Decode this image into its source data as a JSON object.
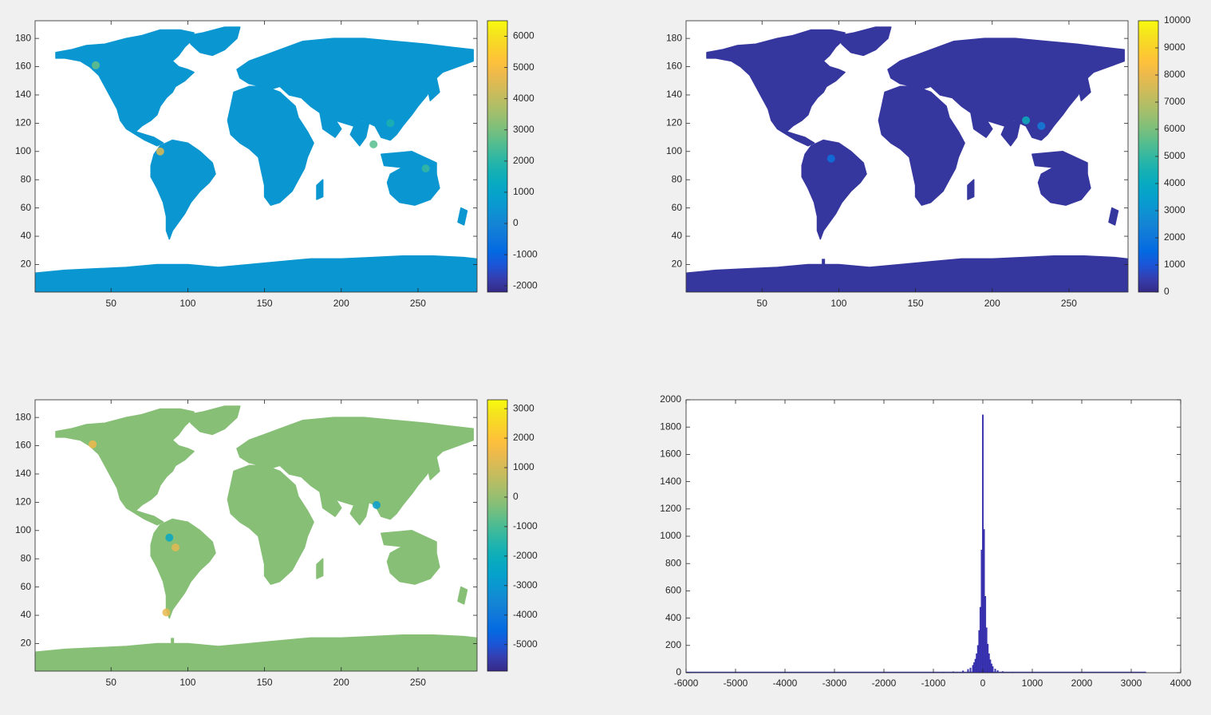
{
  "chart_data": [
    {
      "type": "heatmap",
      "panel": "top-left",
      "xlim": [
        0.5,
        288.5
      ],
      "ylim": [
        0.5,
        192.5
      ],
      "x_ticks": [
        50,
        100,
        150,
        200,
        250
      ],
      "y_ticks": [
        20,
        40,
        60,
        80,
        100,
        120,
        140,
        160,
        180
      ],
      "colorbar": {
        "limits": [
          -2200,
          6500
        ],
        "ticks": [
          -2000,
          -1000,
          0,
          1000,
          2000,
          3000,
          4000,
          5000,
          6000
        ]
      },
      "land_base_value": 500,
      "highlights": [
        {
          "x": 82,
          "y": 100,
          "value": 4500
        },
        {
          "x": 40,
          "y": 161,
          "value": 2800
        },
        {
          "x": 221,
          "y": 105,
          "value": 2600
        },
        {
          "x": 255,
          "y": 88,
          "value": 2200
        },
        {
          "x": 232,
          "y": 120,
          "value": 1800
        }
      ]
    },
    {
      "type": "heatmap",
      "panel": "top-right",
      "xlim": [
        0.5,
        288.5
      ],
      "ylim": [
        0.5,
        192.5
      ],
      "x_ticks": [
        50,
        100,
        150,
        200,
        250
      ],
      "y_ticks": [
        20,
        40,
        60,
        80,
        100,
        120,
        140,
        160,
        180
      ],
      "colorbar": {
        "limits": [
          0,
          10000
        ],
        "ticks": [
          0,
          1000,
          2000,
          3000,
          4000,
          5000,
          6000,
          7000,
          8000,
          9000,
          10000
        ]
      },
      "land_base_value": 300,
      "highlights": [
        {
          "x": 95,
          "y": 95,
          "value": 1800
        },
        {
          "x": 222,
          "y": 122,
          "value": 4200
        },
        {
          "x": 232,
          "y": 118,
          "value": 2200
        }
      ]
    },
    {
      "type": "heatmap",
      "panel": "bottom-left",
      "xlim": [
        0.5,
        288.5
      ],
      "ylim": [
        0.5,
        192.5
      ],
      "x_ticks": [
        50,
        100,
        150,
        200,
        250
      ],
      "y_ticks": [
        20,
        40,
        60,
        80,
        100,
        120,
        140,
        160,
        180
      ],
      "colorbar": {
        "limits": [
          -5900,
          3300
        ],
        "ticks": [
          -5000,
          -4000,
          -3000,
          -2000,
          -1000,
          0,
          1000,
          2000,
          3000
        ]
      },
      "land_base_value": -200,
      "highlights": [
        {
          "x": 88,
          "y": 95,
          "value": -2300
        },
        {
          "x": 92,
          "y": 88,
          "value": 1300
        },
        {
          "x": 38,
          "y": 161,
          "value": 1500
        },
        {
          "x": 223,
          "y": 118,
          "value": -2800
        },
        {
          "x": 86,
          "y": 42,
          "value": 1400
        }
      ]
    },
    {
      "type": "bar",
      "panel": "bottom-right",
      "xlim": [
        -6000,
        4000
      ],
      "ylim": [
        0,
        2000
      ],
      "x_ticks": [
        -6000,
        -5000,
        -4000,
        -3000,
        -2000,
        -1000,
        0,
        1000,
        2000,
        3000,
        4000
      ],
      "y_ticks": [
        0,
        200,
        400,
        600,
        800,
        1000,
        1200,
        1400,
        1600,
        1800,
        2000
      ],
      "bin_width": 25,
      "bins": [
        {
          "x": -1000,
          "value": 2
        },
        {
          "x": -800,
          "value": 4
        },
        {
          "x": -600,
          "value": 7
        },
        {
          "x": -400,
          "value": 14
        },
        {
          "x": -300,
          "value": 25
        },
        {
          "x": -250,
          "value": 35
        },
        {
          "x": -200,
          "value": 55
        },
        {
          "x": -175,
          "value": 75
        },
        {
          "x": -150,
          "value": 100
        },
        {
          "x": -125,
          "value": 140
        },
        {
          "x": -100,
          "value": 200
        },
        {
          "x": -75,
          "value": 310
        },
        {
          "x": -50,
          "value": 480
        },
        {
          "x": -25,
          "value": 900
        },
        {
          "x": 0,
          "value": 1890
        },
        {
          "x": 25,
          "value": 1050
        },
        {
          "x": 50,
          "value": 560
        },
        {
          "x": 75,
          "value": 330
        },
        {
          "x": 100,
          "value": 210
        },
        {
          "x": 125,
          "value": 140
        },
        {
          "x": 150,
          "value": 95
        },
        {
          "x": 175,
          "value": 65
        },
        {
          "x": 200,
          "value": 45
        },
        {
          "x": 250,
          "value": 28
        },
        {
          "x": 300,
          "value": 16
        },
        {
          "x": 400,
          "value": 9
        },
        {
          "x": 600,
          "value": 4
        },
        {
          "x": 1000,
          "value": 2
        }
      ]
    }
  ]
}
